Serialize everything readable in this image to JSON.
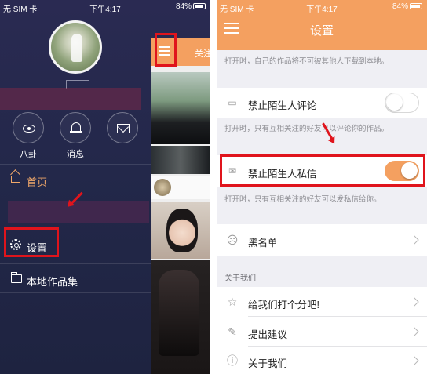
{
  "status_left": {
    "carrier": "无 SIM 卡 ",
    "time": "下午4:17",
    "battery": "84%"
  },
  "status_right": {
    "carrier": "无 SIM 卡 ",
    "time": "下午4:17",
    "battery": "84%"
  },
  "drawer": {
    "quick_actions": [
      {
        "icon": "eye-icon",
        "label": "八卦"
      },
      {
        "icon": "bell-icon",
        "label": "消息"
      },
      {
        "icon": "mail-icon",
        "label": ""
      }
    ],
    "menu": [
      {
        "icon": "home-icon",
        "label": "首页"
      },
      {
        "icon": "gear-icon",
        "label": "设置"
      },
      {
        "icon": "folder-icon",
        "label": "本地作品集"
      }
    ]
  },
  "feed": {
    "tab_label": "关注"
  },
  "settings": {
    "title": "设置",
    "top_note": "打开时，自己的作品将不可被其他人下载到本地。",
    "items": [
      {
        "label": "禁止陌生人评论",
        "toggle_on": false,
        "note": "打开时，只有互相关注的好友可以评论你的作品。"
      },
      {
        "label": "禁止陌生人私信",
        "toggle_on": true,
        "note": "打开时，只有互相关注的好友可以发私信给你。"
      }
    ],
    "blacklist_label": "黑名单",
    "about_section": "关于我们",
    "about_items": [
      {
        "icon": "star-icon",
        "label": "给我们打个分吧!"
      },
      {
        "icon": "edit-icon",
        "label": "提出建议"
      },
      {
        "icon": "info-icon",
        "label": "关于我们"
      }
    ]
  },
  "colors": {
    "accent": "#f4a060",
    "highlight": "#e0141c",
    "drawer_bg": "#23284a"
  }
}
